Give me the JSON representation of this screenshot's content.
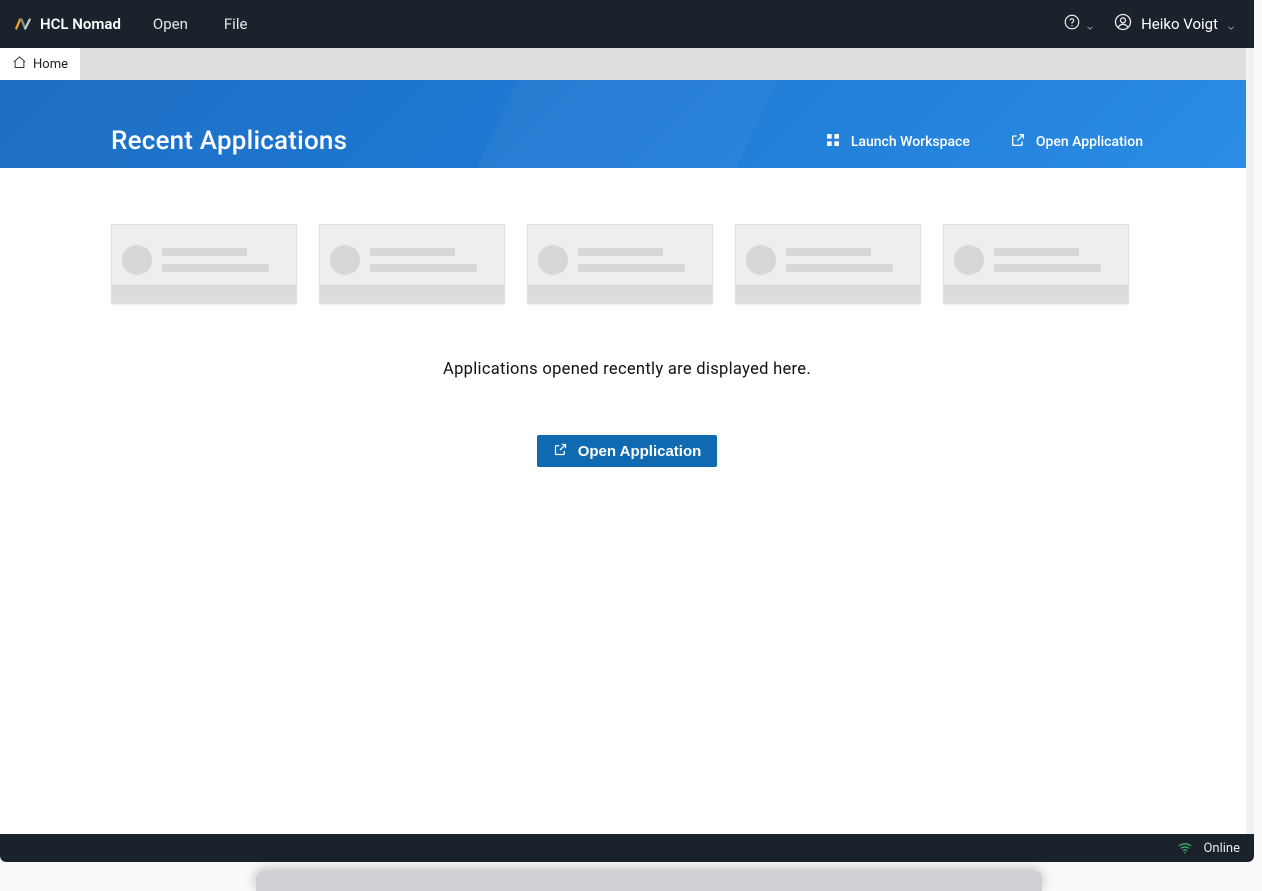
{
  "header": {
    "brand": "HCL Nomad",
    "menu": [
      "Open",
      "File"
    ],
    "user_name": "Heiko Voigt"
  },
  "tabs": {
    "home_label": "Home"
  },
  "banner": {
    "title": "Recent Applications",
    "launch_workspace_label": "Launch Workspace",
    "open_application_label": "Open Application"
  },
  "content": {
    "empty_message": "Applications opened recently are displayed here.",
    "cta_label": "Open Application"
  },
  "status": {
    "connectivity": "Online"
  }
}
